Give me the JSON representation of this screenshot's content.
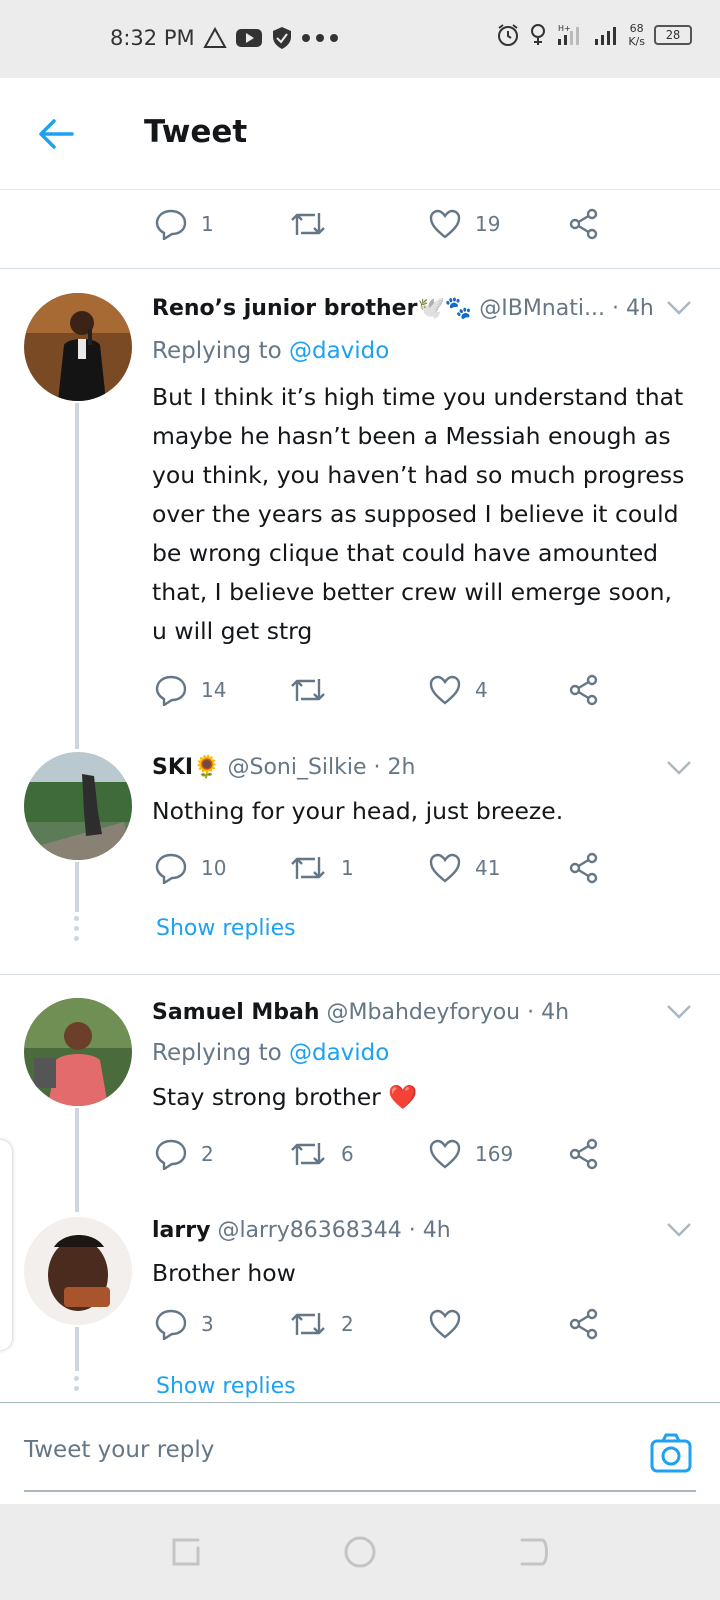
{
  "status_bar": {
    "time": "8:32 PM",
    "speed_value": "68",
    "speed_unit": "K/s",
    "battery": "28",
    "icons": [
      "warning-triangle-icon",
      "youtube-icon",
      "shield-icon",
      "more-dots-icon",
      "alarm-icon",
      "location-icon",
      "signal-icon",
      "signal-icon",
      "battery-icon"
    ]
  },
  "header": {
    "title": "Tweet",
    "back_icon": "back-arrow-icon"
  },
  "main_tweet_actions": {
    "replies": "1",
    "retweets": "",
    "likes": "19"
  },
  "tweets": [
    {
      "name": "Reno’s junior brother🕊️🐾",
      "handle": "@IBMnati...",
      "time": "· 4h",
      "replying_prefix": "Replying to",
      "replying_to": "@davido",
      "text": "But I think it’s high time you understand that maybe he hasn’t been a Messiah enough as you think, you haven’t had so much progress over the years as supposed I believe it could be wrong clique that could have amounted that, I believe better crew will emerge soon, u will get strg",
      "replies": "14",
      "retweets": "",
      "likes": "4"
    },
    {
      "name": "SKI🌻",
      "handle": "@Soni_Silkie",
      "time": "· 2h",
      "text": "Nothing for your head, just breeze.",
      "replies": "10",
      "retweets": "1",
      "likes": "41",
      "show_replies": "Show replies"
    },
    {
      "name": "Samuel Mbah",
      "handle": "@Mbahdeyforyou",
      "time": "· 4h",
      "replying_prefix": "Replying to",
      "replying_to": "@davido",
      "text": "Stay strong brother ❤️",
      "replies": "2",
      "retweets": "6",
      "likes": "169"
    },
    {
      "name": "larry",
      "handle": "@larry86368344",
      "time": "· 4h",
      "text": "Brother how",
      "replies": "3",
      "retweets": "2",
      "likes": "",
      "show_replies": "Show replies"
    }
  ],
  "reply_box": {
    "placeholder": "Tweet your reply"
  },
  "colors": {
    "accent": "#1da1f2",
    "muted": "#657786",
    "text": "#14171a",
    "divider": "#d6dde3"
  }
}
